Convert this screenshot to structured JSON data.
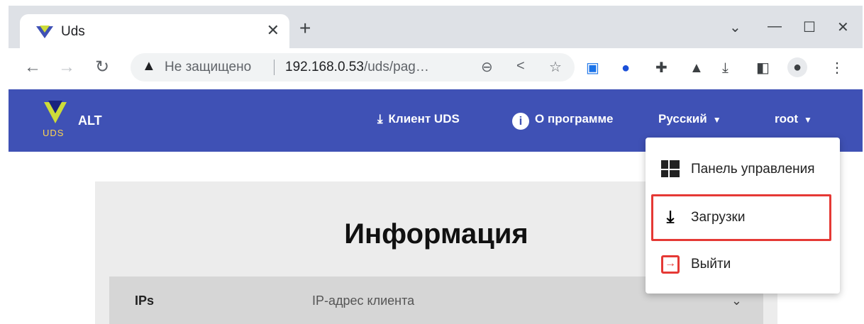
{
  "browser": {
    "tab_title": "Uds",
    "close_glyph": "✕",
    "new_tab_glyph": "+",
    "omnibox": {
      "security_label": "Не защищено",
      "url_host": "192.168.0.53",
      "url_path": "/uds/pag…"
    }
  },
  "navbar": {
    "brand_logo_text": "UDS",
    "brand_name": "ALT",
    "client_label": "Клиент UDS",
    "about_label": "О программе",
    "language_label": "Русский",
    "user_label": "root"
  },
  "content": {
    "title": "Информация",
    "panel": {
      "key": "IPs",
      "value": "IP-адрес клиента"
    }
  },
  "user_menu": {
    "items": [
      {
        "label": "Панель управления",
        "icon": "dashboard-icon"
      },
      {
        "label": "Загрузки",
        "icon": "download-icon",
        "highlighted": true
      },
      {
        "label": "Выйти",
        "icon": "exit-icon"
      }
    ]
  },
  "colors": {
    "navbar": "#3f51b5",
    "highlight": "#e53935"
  }
}
